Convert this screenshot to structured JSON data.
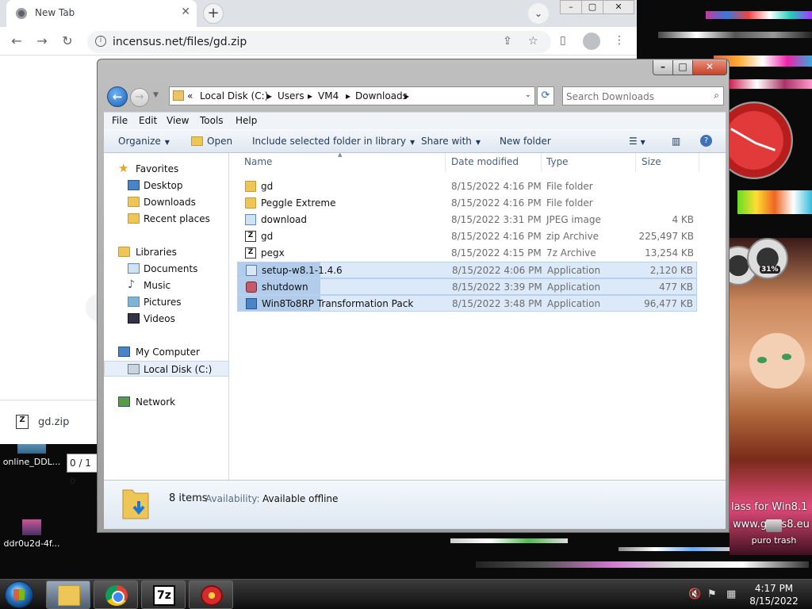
{
  "chrome": {
    "tab_title": "New Tab",
    "tab_close": "✕",
    "new_tab": "+",
    "tab_search": "⌄",
    "url": "incensus.net/files/gd.zip",
    "download_item": "gd.zip"
  },
  "desktop": {
    "icons": [
      {
        "label": "online_DDL..."
      },
      {
        "label": "ddr0u2d-4f..."
      }
    ],
    "progress_text": "0 / 1 o",
    "wallpaper_text_1": "lass for Win8.1",
    "wallpaper_text_2": "www.glass8.eu",
    "trash_label": "puro trash",
    "gadget_percent": "31%"
  },
  "explorer": {
    "breadcrumb": [
      "«",
      "Local Disk (C:)",
      "Users",
      "VM4",
      "Downloads"
    ],
    "search_placeholder": "Search Downloads",
    "menu": [
      "File",
      "Edit",
      "View",
      "Tools",
      "Help"
    ],
    "commands": {
      "organize": "Organize",
      "open": "Open",
      "include": "Include selected folder in library",
      "share": "Share with",
      "new_folder": "New folder"
    },
    "nav": {
      "favorites": "Favorites",
      "desktop": "Desktop",
      "downloads": "Downloads",
      "recent": "Recent places",
      "libraries": "Libraries",
      "documents": "Documents",
      "music": "Music",
      "pictures": "Pictures",
      "videos": "Videos",
      "my_computer": "My Computer",
      "local_disk": "Local Disk (C:)",
      "network": "Network"
    },
    "columns": {
      "name": "Name",
      "date": "Date modified",
      "type": "Type",
      "size": "Size"
    },
    "files": [
      {
        "name": "gd",
        "date": "8/15/2022 4:16 PM",
        "type": "File folder",
        "size": "",
        "icon": "folder-icon"
      },
      {
        "name": "Peggle Extreme",
        "date": "8/15/2022 4:16 PM",
        "type": "File folder",
        "size": "",
        "icon": "folder-icon"
      },
      {
        "name": "download",
        "date": "8/15/2022 3:31 PM",
        "type": "JPEG image",
        "size": "4 KB",
        "icon": "jpeg-icon"
      },
      {
        "name": "gd",
        "date": "8/15/2022 4:16 PM",
        "type": "zip Archive",
        "size": "225,497 KB",
        "icon": "zip-icon"
      },
      {
        "name": "pegx",
        "date": "8/15/2022 4:15 PM",
        "type": "7z Archive",
        "size": "13,254 KB",
        "icon": "zip-icon"
      },
      {
        "name": "setup-w8.1-1.4.6",
        "date": "8/15/2022 4:06 PM",
        "type": "Application",
        "size": "2,120 KB",
        "icon": "exe-icon"
      },
      {
        "name": "shutdown",
        "date": "8/15/2022 3:39 PM",
        "type": "Application",
        "size": "477 KB",
        "icon": "shutdown-icon"
      },
      {
        "name": "Win8To8RP Transformation Pack",
        "date": "8/15/2022 3:48 PM",
        "type": "Application",
        "size": "96,477 KB",
        "icon": "transformation-pack-icon"
      }
    ],
    "details": {
      "count": "8 items",
      "availability_label": "Availability:",
      "availability_value": "Available offline"
    }
  },
  "taskbar": {
    "time": "4:17 PM",
    "date": "8/15/2022",
    "sevenz_label": "7z"
  },
  "colors": {
    "selection": "#dbe9f8",
    "accent": "#1a5fb0",
    "window_frame": "#bfbfbf"
  }
}
